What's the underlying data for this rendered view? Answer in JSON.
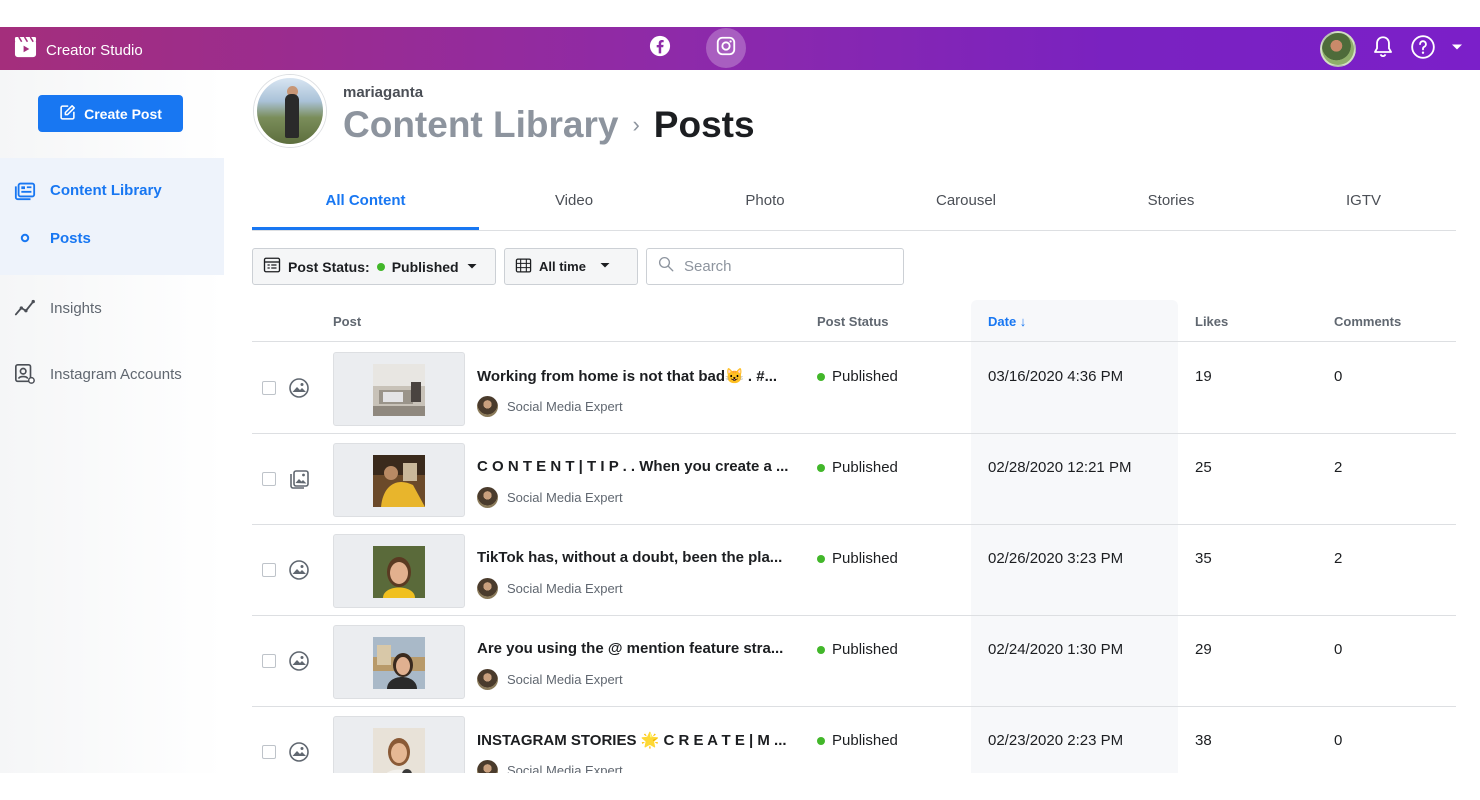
{
  "app": {
    "title": "Creator Studio"
  },
  "sidebar": {
    "create_post_label": "Create Post",
    "items": [
      {
        "label": "Content Library"
      },
      {
        "label": "Posts"
      },
      {
        "label": "Insights"
      },
      {
        "label": "Instagram Accounts"
      }
    ]
  },
  "header": {
    "username": "mariaganta",
    "breadcrumb_parent": "Content Library",
    "breadcrumb_separator": "›",
    "breadcrumb_current": "Posts"
  },
  "tabs": [
    {
      "label": "All Content",
      "active": true
    },
    {
      "label": "Video"
    },
    {
      "label": "Photo"
    },
    {
      "label": "Carousel"
    },
    {
      "label": "Stories"
    },
    {
      "label": "IGTV"
    }
  ],
  "filters": {
    "post_status_label": "Post Status:",
    "post_status_value": "Published",
    "time_label": "All time",
    "search_placeholder": "Search"
  },
  "table": {
    "columns": {
      "post": "Post",
      "status": "Post Status",
      "date": "Date ↓",
      "likes": "Likes",
      "comments": "Comments"
    },
    "rows": [
      {
        "title": "Working from home is not that bad😺  . #...",
        "author": "Social Media Expert",
        "status": "Published",
        "date": "03/16/2020 4:36 PM",
        "likes": "19",
        "comments": "0",
        "type_icon": "photo-icon"
      },
      {
        "title": "C O N T E N T | T I P . . When you create a ...",
        "author": "Social Media Expert",
        "status": "Published",
        "date": "02/28/2020 12:21 PM",
        "likes": "25",
        "comments": "2",
        "type_icon": "carousel-icon"
      },
      {
        "title": "TikTok has, without a doubt, been the pla...",
        "author": "Social Media Expert",
        "status": "Published",
        "date": "02/26/2020 3:23 PM",
        "likes": "35",
        "comments": "2",
        "type_icon": "photo-icon"
      },
      {
        "title": "Are you using the @ mention feature stra...",
        "author": "Social Media Expert",
        "status": "Published",
        "date": "02/24/2020 1:30 PM",
        "likes": "29",
        "comments": "0",
        "type_icon": "photo-icon"
      },
      {
        "title": "INSTAGRAM STORIES 🌟  C R E A T E | M ...",
        "author": "Social Media Expert",
        "status": "Published",
        "date": "02/23/2020 2:23 PM",
        "likes": "38",
        "comments": "0",
        "type_icon": "photo-icon"
      }
    ]
  },
  "colors": {
    "accent": "#1877f2",
    "status_published": "#42b72a",
    "appbar_start": "#a42e7c",
    "appbar_end": "#7b1fc9"
  }
}
